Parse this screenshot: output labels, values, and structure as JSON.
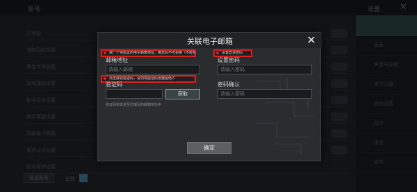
{
  "background": {
    "title": "账号",
    "settings_title": "设置",
    "close_icon": "✕",
    "rows": [
      "已绑定",
      "领取回收设置",
      "角色专属设置",
      "游戏通知设置",
      "账号登出设置",
      "联系客服设置",
      "关联电子邮箱",
      "实名认证设置",
      "账号保护设置"
    ],
    "sidebar": [
      "账号",
      "画面",
      "声音与界面",
      "操作设置",
      "其他设置",
      "战斗",
      "语言",
      "通知"
    ],
    "footer_button": "退出账号",
    "footer_label": "记住"
  },
  "modal": {
    "title": "关联电子邮箱",
    "close_icon": "✕",
    "hint_email": "填一个待验证的电子邮箱地址，绑定后不可更换（不能使用QQ邮箱）",
    "hint_password": "设置登录密码",
    "hint_code": "点击获取验证码，请勿将验证码泄露给他人",
    "email_label": "邮箱地址",
    "email_placeholder": "请输入邮箱",
    "password_label": "设置密码",
    "password_placeholder": "请输入密码",
    "code_label": "验证码",
    "code_value": "",
    "fetch_button": "获取",
    "confirm_label": "密码确认",
    "confirm_placeholder": "请输入密码",
    "note": "验证码将发送至您填写的邮箱地址中",
    "confirm_button": "确定"
  }
}
